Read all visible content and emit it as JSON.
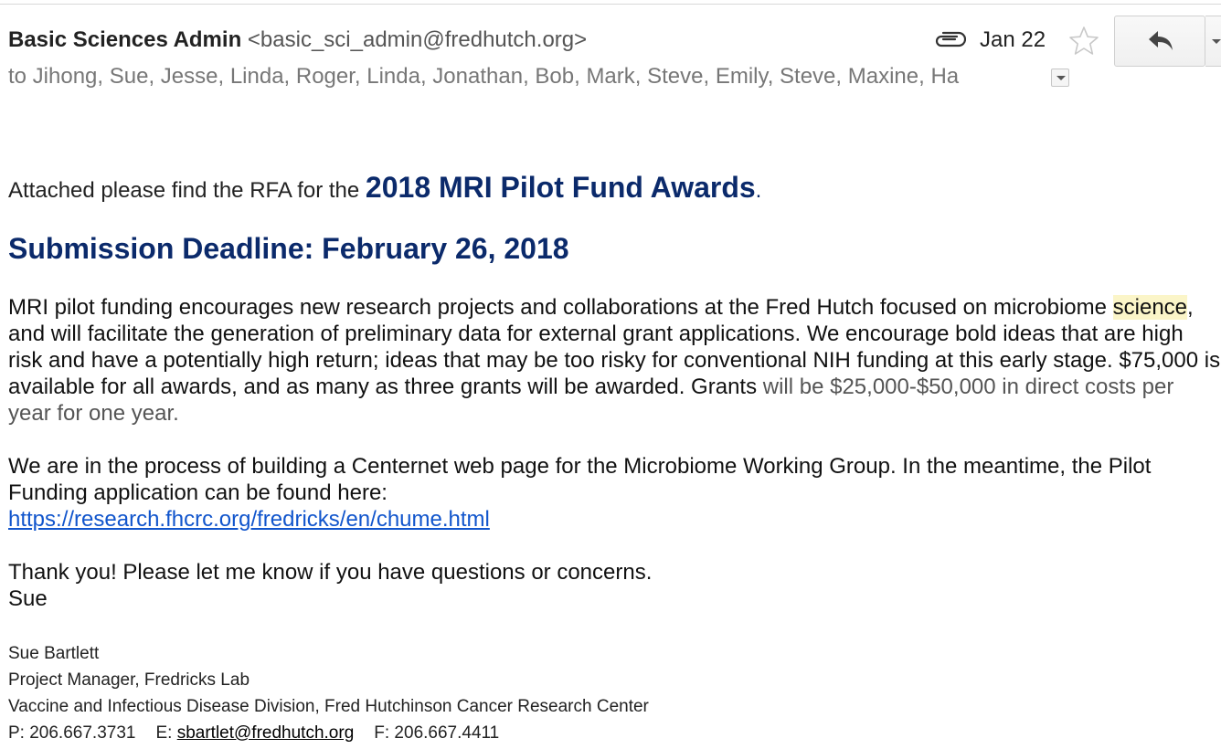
{
  "header": {
    "sender_name": "Basic Sciences Admin",
    "sender_email": "<basic_sci_admin@fredhutch.org>",
    "recipients": "to Jihong, Sue, Jesse, Linda, Roger, Linda, Jonathan, Bob, Mark, Steve, Emily, Steve, Maxine, Ha",
    "date": "Jan 22",
    "icons": {
      "attachment": "paperclip-icon",
      "star": "star-icon",
      "reply": "reply-icon",
      "more": "chevron-down-icon",
      "details": "dropdown-arrow-icon"
    }
  },
  "body": {
    "intro_text": "Attached please find the RFA for the ",
    "awards_title": "2018 MRI Pilot Fund Awards",
    "awards_period": ".",
    "deadline": "Submission Deadline: February 26, 2018",
    "para1_a": "MRI pilot funding encourages new research projects and collaborations at the Fred Hutch focused on microbiome ",
    "para1_highlight": "science",
    "para1_b": ", and will facilitate the generation of preliminary data for external grant applications. We encourage bold ideas that are high risk and have a potentially high return; ideas that may be too risky for conventional NIH funding at this early stage. $75,000 is available for all awards, and as many as three grants will be awarded. Grants ",
    "para1_c": "will be $25,000-$50,000 in direct costs per year for one year.",
    "para2_text": "We are in the process of building a Centernet web page for the Microbiome Working Group. In the meantime, the Pilot Funding application can be found here:",
    "para2_link": "https://research.fhcrc.org/fredricks/en/chume.html",
    "thanks": "Thank you! Please let me know if you have questions or concerns.",
    "signoff": "Sue"
  },
  "signature": {
    "name": "Sue Bartlett",
    "title": "Project Manager, Fredricks Lab",
    "division": "Vaccine and Infectious Disease Division, Fred Hutchinson Cancer Research Center",
    "phone": "P: 206.667.3731",
    "email_label": "E: ",
    "email": "sbartlet@fredhutch.org",
    "fax": "F: 206.667.4411"
  },
  "colors": {
    "heading_blue": "#0b2a6b",
    "link_blue": "#1155cc",
    "highlight": "#fbf5c8"
  }
}
